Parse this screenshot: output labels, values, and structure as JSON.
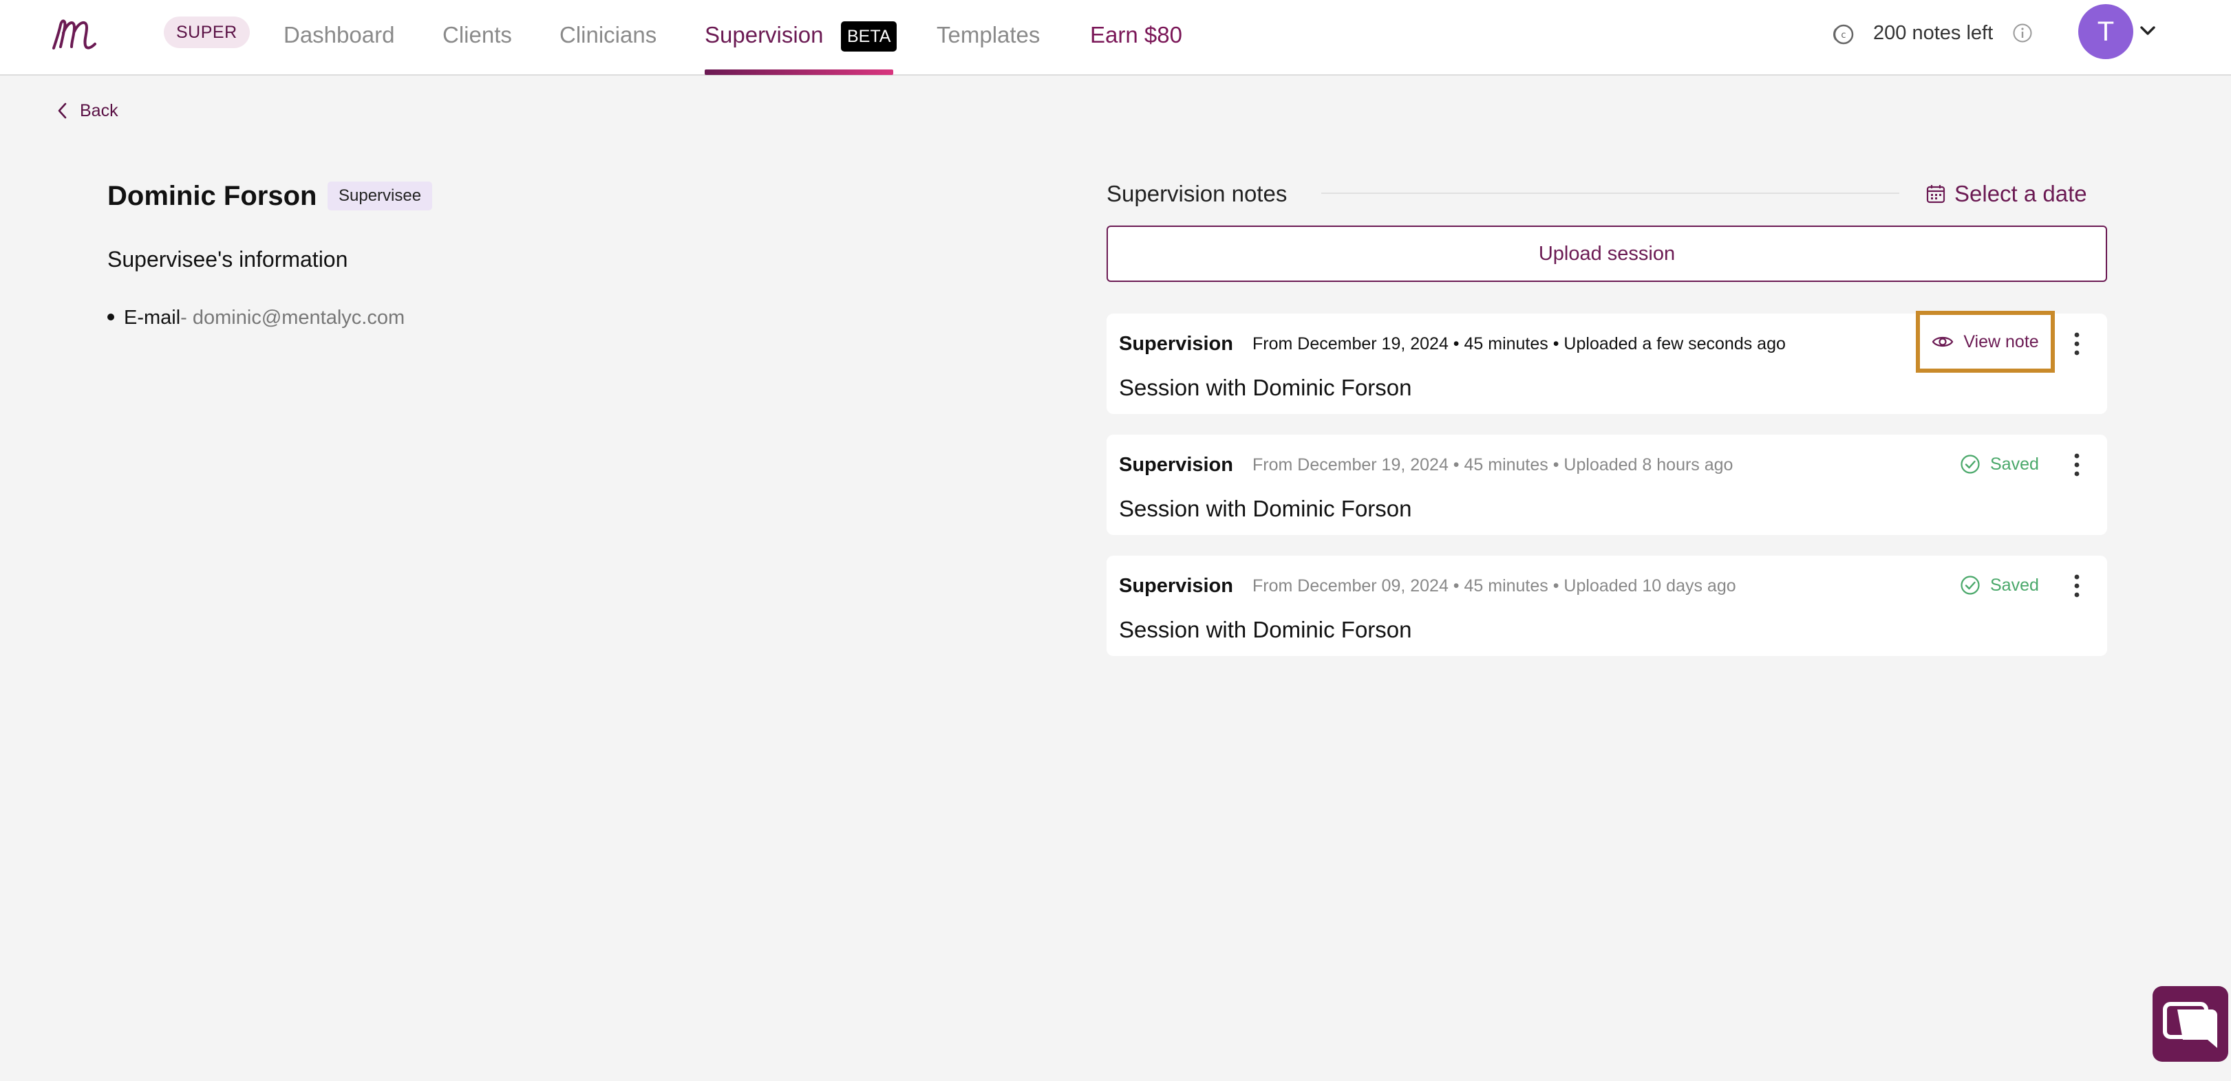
{
  "nav": {
    "super_badge": "SUPER",
    "items": [
      {
        "label": "Dashboard"
      },
      {
        "label": "Clients"
      },
      {
        "label": "Clinicians"
      },
      {
        "label": "Supervision"
      },
      {
        "label": "Templates"
      },
      {
        "label": "Earn $80"
      }
    ],
    "active_item": "Supervision",
    "beta_badge": "BETA",
    "notes_left": "200 notes left",
    "avatar_initial": "T"
  },
  "back_label": "Back",
  "profile": {
    "name": "Dominic Forson",
    "role_badge": "Supervisee",
    "info_title": "Supervisee's information",
    "email_label": "E-mail",
    "email_separator": "- ",
    "email_value": "dominic@mentalyc.com"
  },
  "notes_panel": {
    "title": "Supervision notes",
    "select_date": "Select a date",
    "upload_label": "Upload session",
    "cards": [
      {
        "type": "Supervision",
        "meta": "From December 19, 2024 • 45 minutes • Uploaded a few seconds ago",
        "title": "Session with Dominic Forson",
        "action": "View note"
      },
      {
        "type": "Supervision",
        "meta": "From December 19, 2024 • 45 minutes • Uploaded 8 hours ago",
        "title": "Session with Dominic Forson",
        "status": "Saved"
      },
      {
        "type": "Supervision",
        "meta": "From December 09, 2024 • 45 minutes • Uploaded 10 days ago",
        "title": "Session with Dominic Forson",
        "status": "Saved"
      }
    ]
  },
  "icons": {
    "logo": "mentalyc-logo",
    "credits": "credits-icon",
    "info": "info-icon",
    "avatar_menu": "chevron-down-icon",
    "back": "chevron-left-icon",
    "calendar": "calendar-icon",
    "view": "eye-icon",
    "saved": "check-circle-icon",
    "more": "kebab-icon",
    "chat": "chat-icon"
  },
  "colors": {
    "brand": "#6b1a53",
    "accent_gradient_end": "#d8357e",
    "saved_green": "#4aa86a",
    "highlight_outline": "#c98a2a",
    "avatar": "#8d5fd8"
  }
}
